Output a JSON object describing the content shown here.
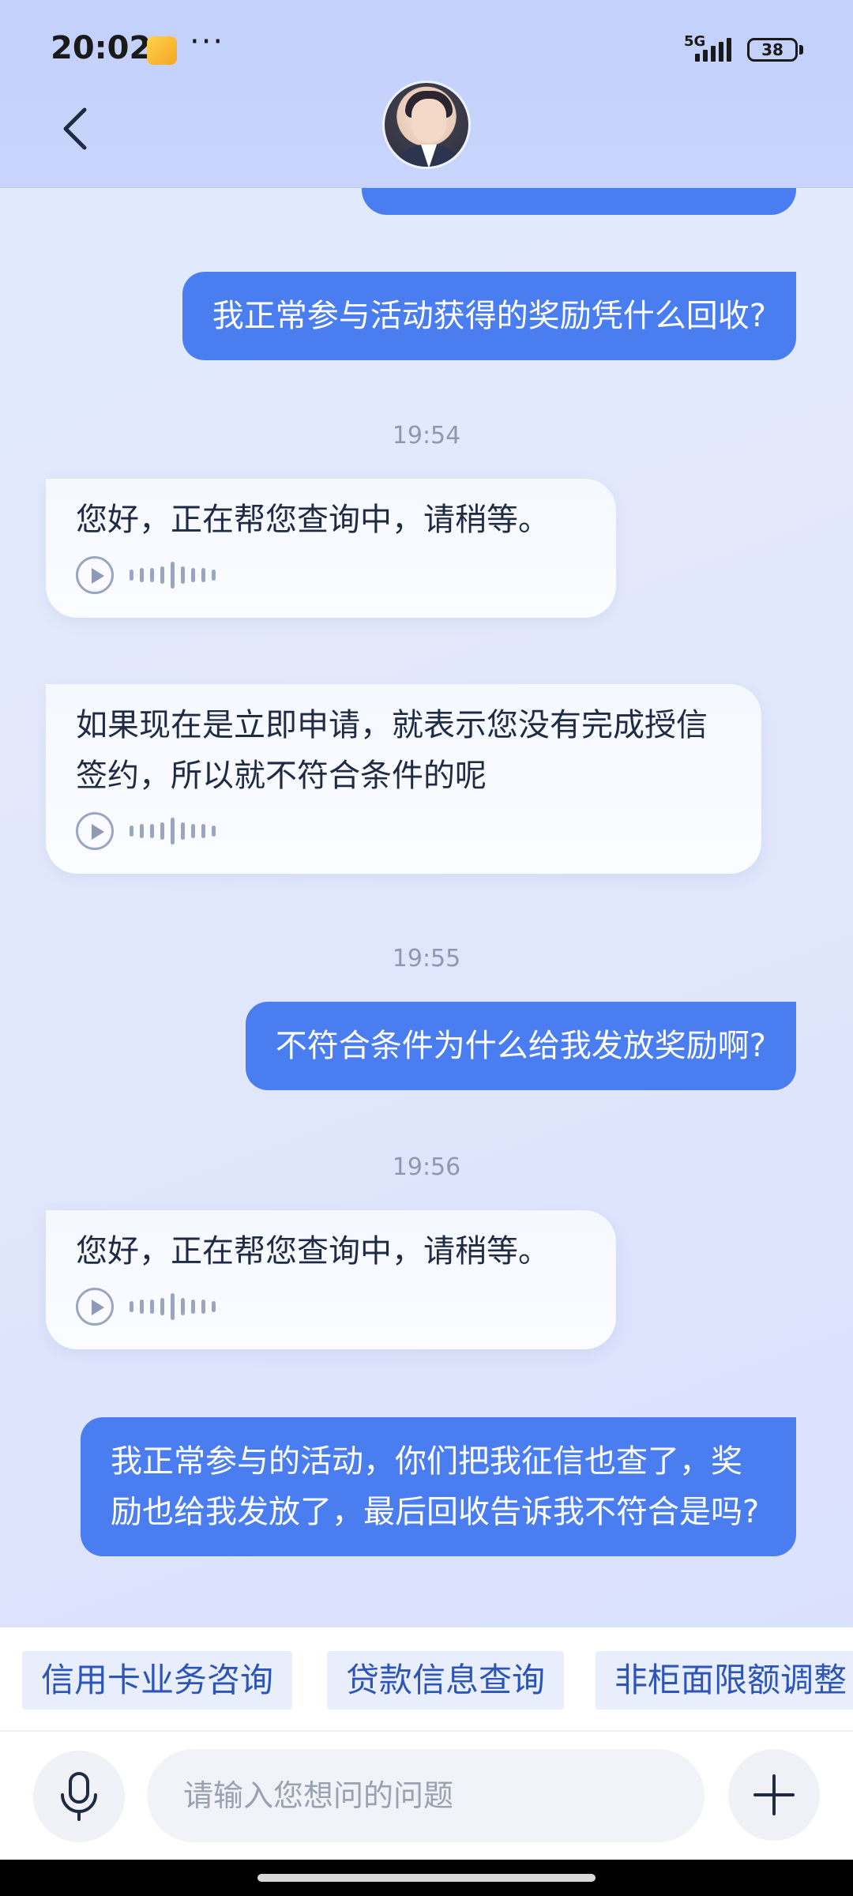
{
  "status_bar": {
    "time": "20:02",
    "more": "···",
    "network": "5G",
    "battery": "38"
  },
  "header": {
    "back_icon": "chevron-left-icon",
    "avatar": "assistant-avatar"
  },
  "messages": [
    {
      "type": "user",
      "text": "我正常参与活动获得的奖励凭什么回收?"
    },
    {
      "type": "time",
      "text": "19:54"
    },
    {
      "type": "bot",
      "text": "您好，正在帮您查询中，请稍等。"
    },
    {
      "type": "bot",
      "text": "如果现在是立即申请，就表示您没有完成授信签约，所以就不符合条件的呢"
    },
    {
      "type": "time",
      "text": "19:55"
    },
    {
      "type": "user",
      "text": "不符合条件为什么给我发放奖励啊?"
    },
    {
      "type": "time",
      "text": "19:56"
    },
    {
      "type": "bot",
      "text": "您好，正在帮您查询中，请稍等。"
    },
    {
      "type": "user",
      "text": "我正常参与的活动，你们把我征信也查了，奖励也给我发放了，最后回收告诉我不符合是吗?"
    }
  ],
  "quick_chips": [
    "信用卡业务咨询",
    "贷款信息查询",
    "非柜面限额调整"
  ],
  "input": {
    "placeholder": "请输入您想问的问题"
  },
  "colors": {
    "user_bubble": "#4a7ef0",
    "chip_text": "#2d55b8",
    "chip_bg": "#e8eefc"
  }
}
